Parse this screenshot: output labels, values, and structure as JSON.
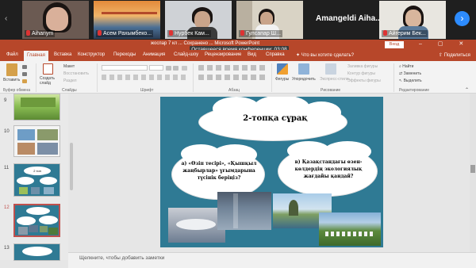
{
  "zoom": {
    "participants": [
      {
        "name": "Aihanym",
        "muted": true
      },
      {
        "name": "Асем Рахымбеко...",
        "muted": true
      },
      {
        "name": "Нурбек Кам...",
        "muted": true
      },
      {
        "name": "Гулсапар Ш...",
        "muted": true
      },
      {
        "name": "Amangeldi  Aiha...",
        "muted": false
      },
      {
        "name": "Айгерим Бек...",
        "muted": true
      }
    ],
    "timer": "Оставшееся время конференции: 03:08",
    "next_icon": "chevron-right-icon"
  },
  "window": {
    "doc_title": "жоспар 7 кл ... Сохранено ... Microsoft PowerPoint",
    "signin": "Вход",
    "controls": "– ▢ ✕"
  },
  "tabs": [
    "Файл",
    "Главная",
    "Вставка",
    "Конструктор",
    "Переходы",
    "Анимация",
    "Слайд-шоу",
    "Рецензирование",
    "Вид",
    "Справка"
  ],
  "active_tab": "Главная",
  "tellme": "Что вы хотите сделать?",
  "share": "Поделиться",
  "ribbon": {
    "clipboard": {
      "paste": "Вставить",
      "label": "Буфер обмена"
    },
    "slides": {
      "new_slide": "Создать слайд",
      "layout": "Макет",
      "reset": "Восстановить",
      "section": "Раздел",
      "label": "Слайды"
    },
    "font": {
      "label": "Шрифт"
    },
    "paragraph": {
      "label": "Абзац"
    },
    "drawing": {
      "shapes": "Фигуры",
      "arrange": "Упорядочить",
      "quick_styles": "Экспресс-стили",
      "fill": "Заливка фигуры",
      "outline": "Контур фигуры",
      "effects": "Эффекты фигуры",
      "label": "Рисование"
    },
    "editing": {
      "find": "Найти",
      "replace": "Заменить",
      "select": "Выделить",
      "label": "Редактирование"
    }
  },
  "thumbnails": [
    {
      "number": "9",
      "selected": false
    },
    {
      "number": "10",
      "selected": false
    },
    {
      "number": "11",
      "selected": false,
      "title": "2 топ"
    },
    {
      "number": "12",
      "selected": true
    },
    {
      "number": "13",
      "selected": false
    }
  ],
  "slide": {
    "title_cloud": "2-топқа сұрақ",
    "question_a": "а) «Өзіп тесірі», «Қышқыл жаңбырлар» ұғымдарына түсінік беріңіз?",
    "question_b": "в) Қазақстандағы өзен-көлдердің экологиялық жағдайы қандай?",
    "colors": {
      "background": "#2f7a94",
      "cloud": "#ffffff"
    }
  },
  "notes_placeholder": "Щелкните, чтобы добавить заметки"
}
